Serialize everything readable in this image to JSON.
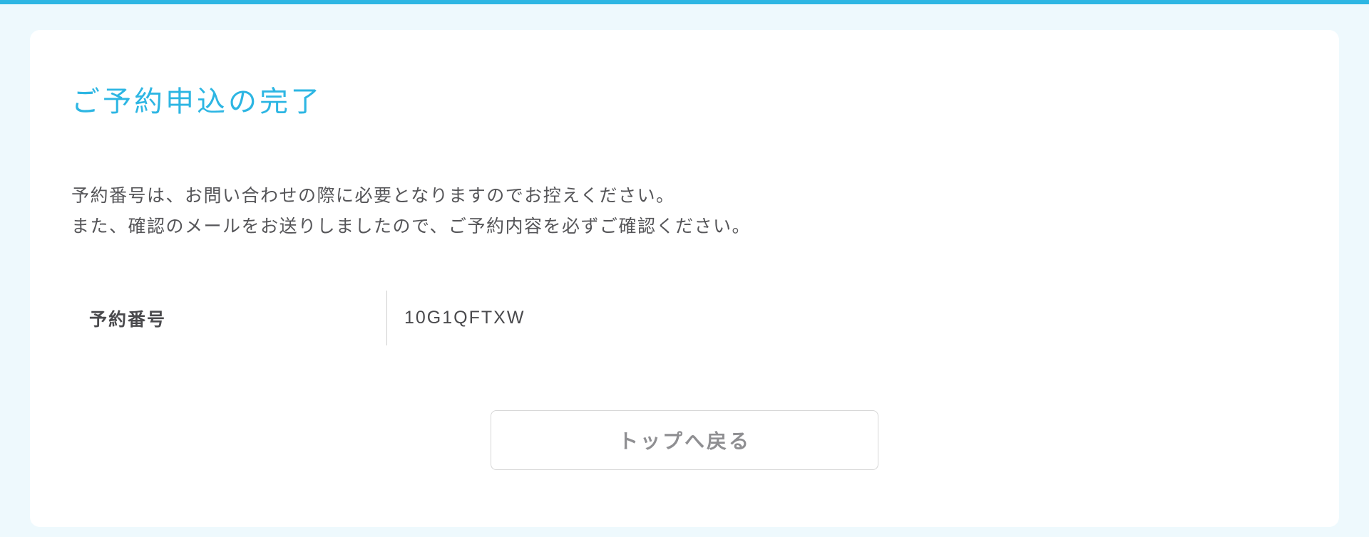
{
  "page": {
    "title": "ご予約申込の完了",
    "description": "予約番号は、お問い合わせの際に必要となりますのでお控えください。\nまた、確認のメールをお送りしましたので、ご予約内容を必ずご確認ください。"
  },
  "reservation": {
    "label": "予約番号",
    "number": "10G1QFTXW"
  },
  "actions": {
    "back_to_top": "トップへ戻る"
  }
}
